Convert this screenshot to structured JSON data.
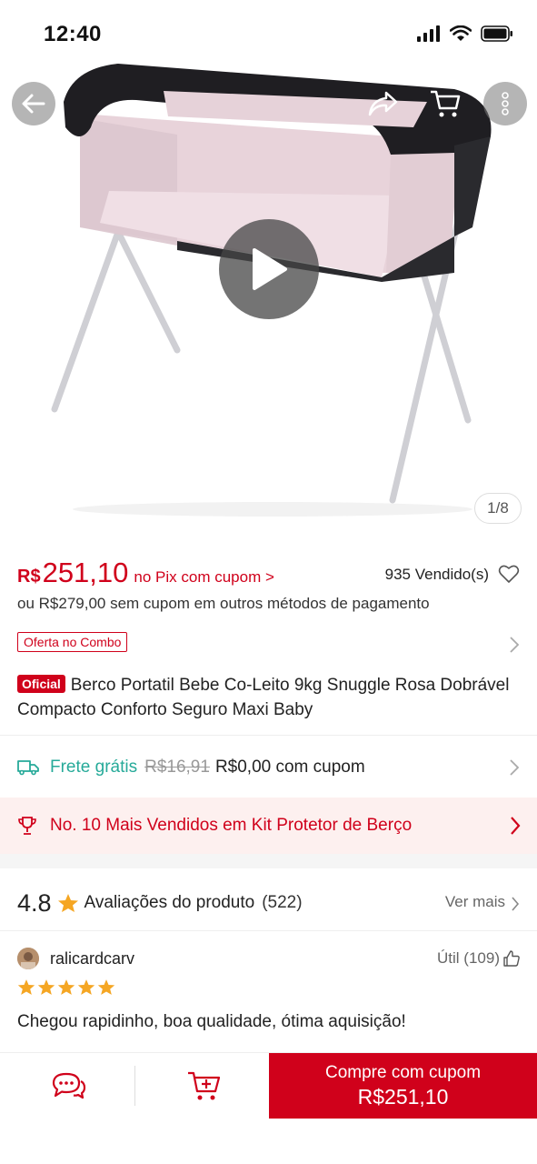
{
  "status_bar": {
    "time": "12:40"
  },
  "hero": {
    "page_indicator": "1/8"
  },
  "price": {
    "currency": "R$",
    "value": "251,10",
    "pix_label": "no Pix com cupom >",
    "sold": "935 Vendido(s)",
    "alt_price": "ou R$279,00 sem cupom em outros métodos de pagamento"
  },
  "combo": {
    "tag": "Oferta no Combo"
  },
  "product": {
    "badge": "Oficial",
    "title": "Berco Portatil Bebe Co-Leito 9kg Snuggle Rosa Dobrável Compacto Conforto Seguro Maxi Baby"
  },
  "shipping": {
    "free_label": "Frete grátis",
    "old_price": "R$16,91",
    "new_price": "R$0,00 com cupom"
  },
  "ranking": {
    "text": "No. 10 Mais Vendidos em Kit Protetor de Berço"
  },
  "ratings": {
    "score": "4.8",
    "label": "Avaliações do produto",
    "count": "(522)",
    "see_more": "Ver mais"
  },
  "review": {
    "username": "ralicardcarv",
    "useful": "Útil (109)",
    "stars": 5,
    "text": "Chegou rapidinho, boa qualidade, ótima aquisição!"
  },
  "bottom_bar": {
    "buy_label": "Compre com cupom",
    "buy_price": "R$251,10"
  },
  "colors": {
    "accent": "#d0011b",
    "shipping": "#26aa99",
    "star": "#f5a623",
    "ranking_bg": "#fdf0ef"
  }
}
